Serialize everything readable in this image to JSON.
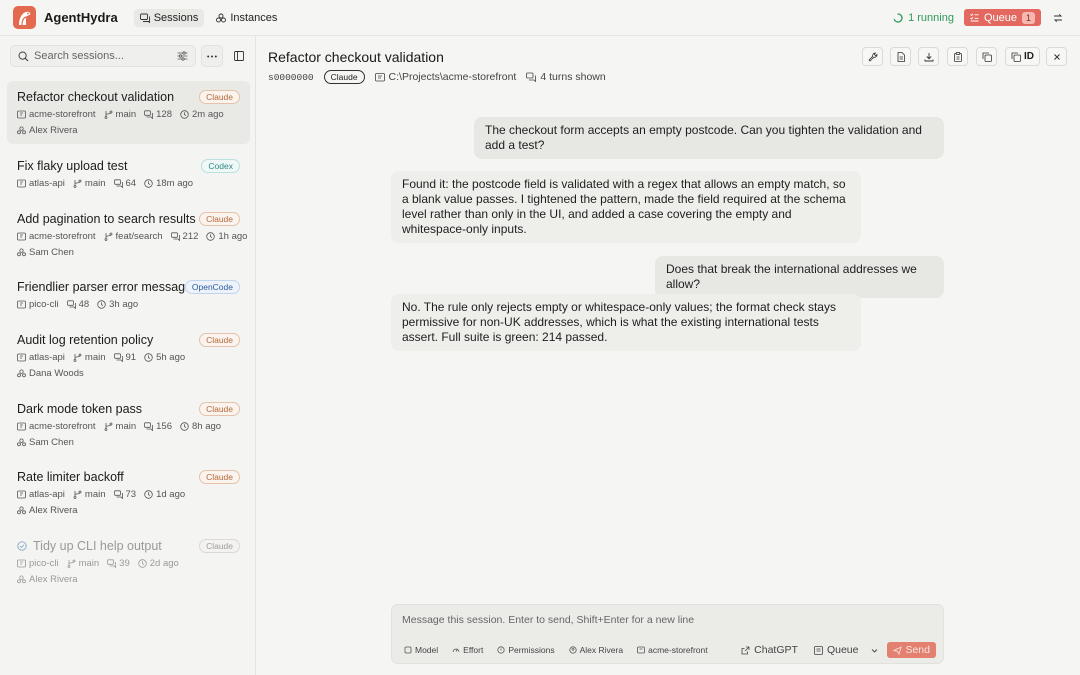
{
  "app": {
    "name": "AgentHydra"
  },
  "nav": {
    "sessions": "Sessions",
    "instances": "Instances"
  },
  "status": {
    "running": "1 running",
    "queue_label": "Queue",
    "queue_count": "1"
  },
  "sidebar": {
    "search_placeholder": "Search sessions...",
    "sessions": [
      {
        "title": "Refactor checkout validation",
        "badge": "Claude",
        "repo": "acme-storefront",
        "branch": "main",
        "turns": "128",
        "time": "2m ago",
        "user": "Alex Rivera"
      },
      {
        "title": "Fix flaky upload test",
        "badge": "Codex",
        "repo": "atlas-api",
        "branch": "main",
        "turns": "64",
        "time": "18m ago",
        "user": ""
      },
      {
        "title": "Add pagination to search results",
        "badge": "Claude",
        "repo": "acme-storefront",
        "branch": "feat/search",
        "turns": "212",
        "time": "1h ago",
        "user": "Sam Chen"
      },
      {
        "title": "Friendlier parser error messages",
        "badge": "OpenCode",
        "repo": "pico-cli",
        "branch": "",
        "turns": "48",
        "time": "3h ago",
        "user": ""
      },
      {
        "title": "Audit log retention policy",
        "badge": "Claude",
        "repo": "atlas-api",
        "branch": "main",
        "turns": "91",
        "time": "5h ago",
        "user": "Dana Woods"
      },
      {
        "title": "Dark mode token pass",
        "badge": "Claude",
        "repo": "acme-storefront",
        "branch": "main",
        "turns": "156",
        "time": "8h ago",
        "user": "Sam Chen"
      },
      {
        "title": "Rate limiter backoff",
        "badge": "Claude",
        "repo": "atlas-api",
        "branch": "main",
        "turns": "73",
        "time": "1d ago",
        "user": "Alex Rivera"
      },
      {
        "title": "Tidy up CLI help output",
        "badge": "Claude",
        "repo": "pico-cli",
        "branch": "main",
        "turns": "39",
        "time": "2d ago",
        "user": "Alex Rivera"
      }
    ]
  },
  "session": {
    "title": "Refactor checkout validation",
    "id": "s0000000",
    "badge": "Claude",
    "path": "C:\\Projects\\acme-storefront",
    "turns_shown": "4 turns shown",
    "id_button": "ID"
  },
  "messages": [
    {
      "role": "user",
      "text": "The checkout form accepts an empty postcode. Can you tighten the validation and add a test?"
    },
    {
      "role": "assistant",
      "text": "Found it: the postcode field is validated with a regex that allows an empty match, so a blank value passes. I tightened the pattern, made the field required at the schema level rather than only in the UI, and added a case covering the empty and whitespace-only inputs."
    },
    {
      "role": "user",
      "text": "Does that break the international addresses we allow?"
    },
    {
      "role": "assistant",
      "text": "No. The rule only rejects empty or whitespace-only values; the format check stays permissive for non-UK addresses, which is what the existing international tests assert. Full suite is green: 214 passed."
    }
  ],
  "composer": {
    "placeholder": "Message this session. Enter to send, Shift+Enter for a new line",
    "model": "Model",
    "effort": "Effort",
    "permissions": "Permissions",
    "user": "Alex Rivera",
    "repo": "acme-storefront",
    "chatgpt": "ChatGPT",
    "queue": "Queue",
    "send": "Send"
  },
  "colors": {
    "accent": "#e3685f",
    "running": "#2e9a5a",
    "claude_badge": "#b36a3c",
    "codex_badge": "#2b8a85",
    "opencode_badge": "#2e5b9a"
  }
}
